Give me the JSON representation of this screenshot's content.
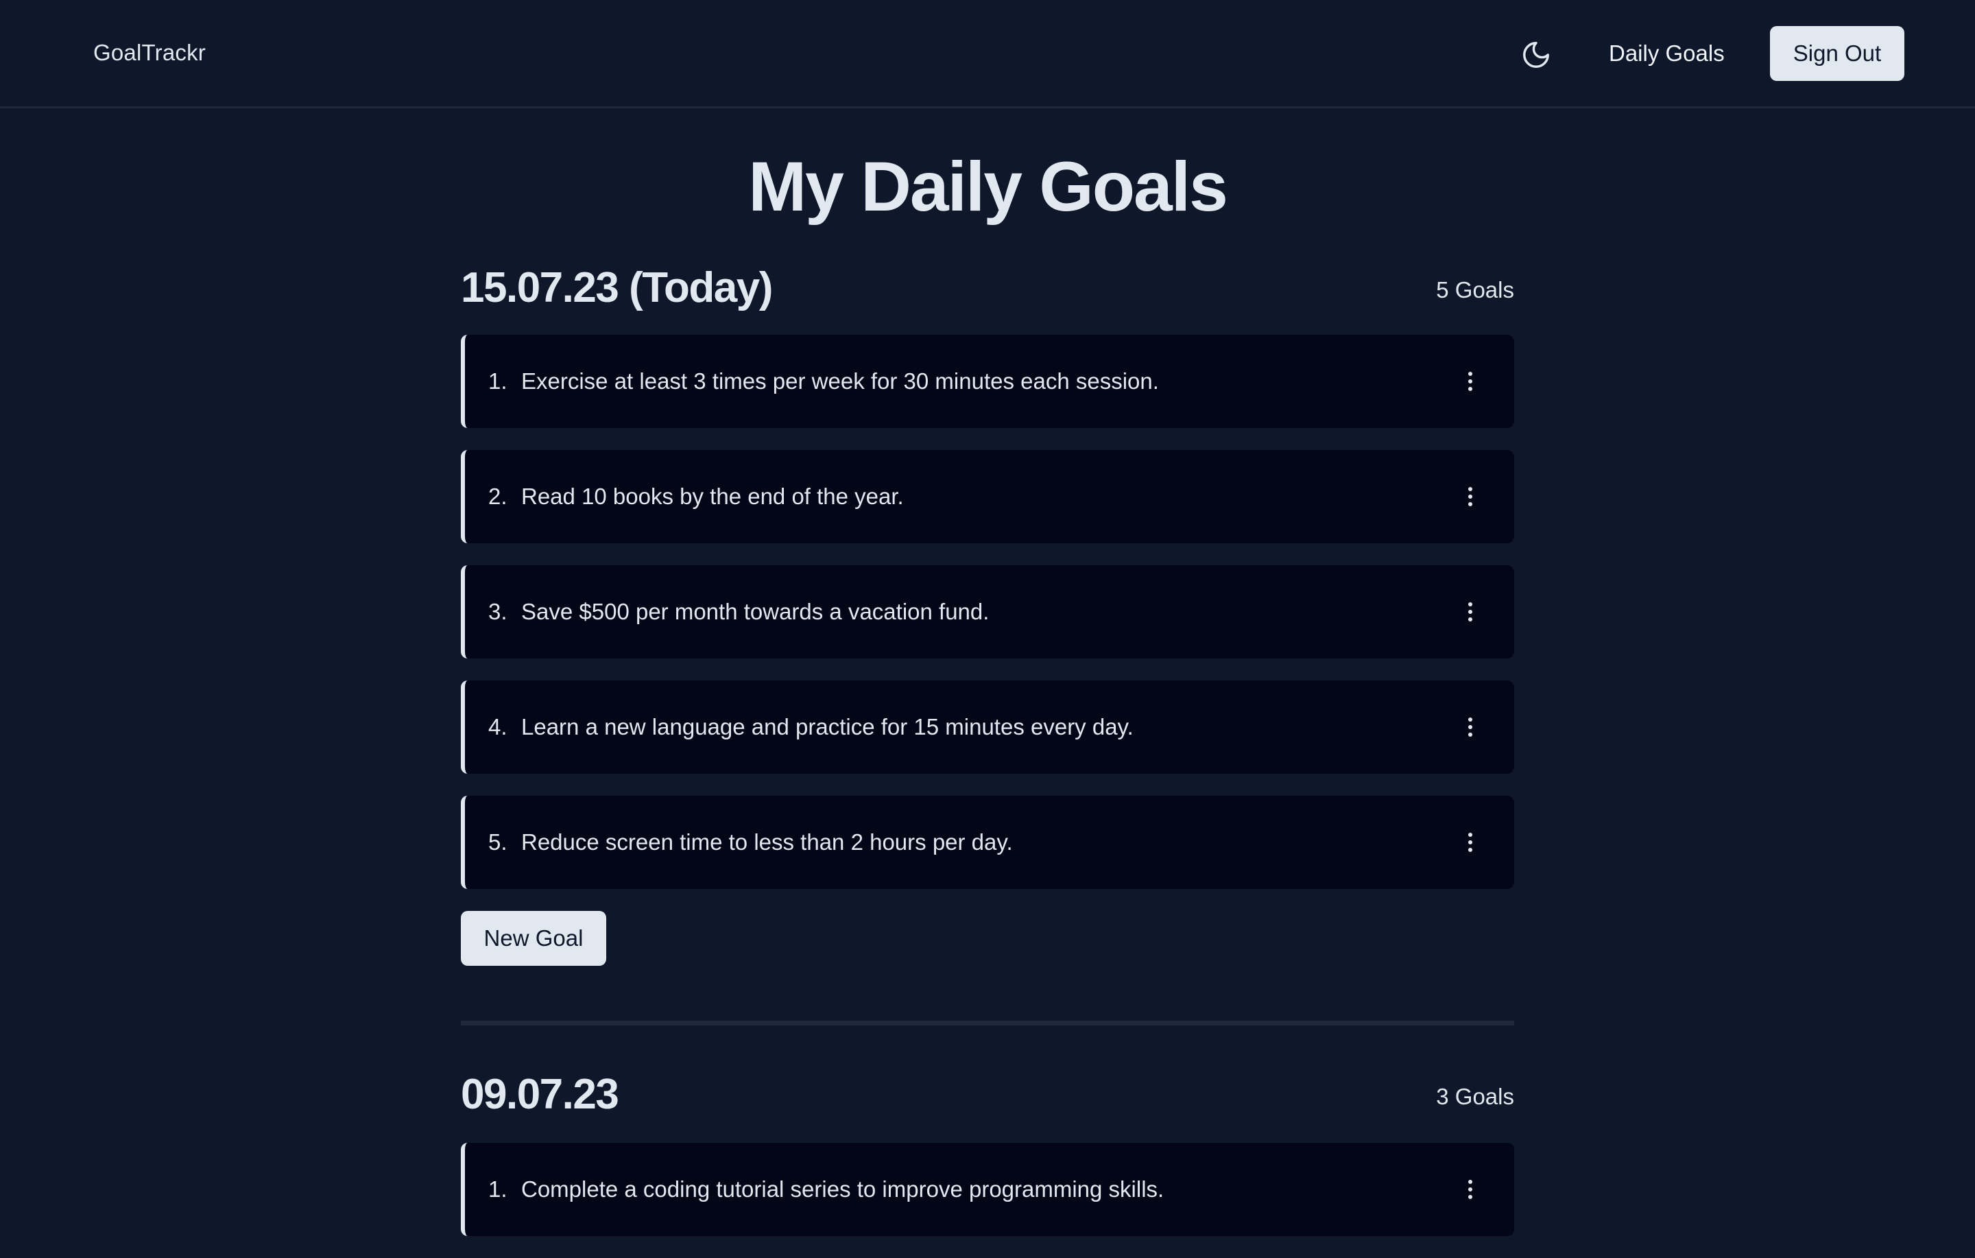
{
  "navbar": {
    "brand": "GoalTrackr",
    "theme_icon": "moon-icon",
    "nav_link": "Daily Goals",
    "sign_out_label": "Sign Out"
  },
  "page": {
    "title": "My Daily Goals"
  },
  "days": [
    {
      "date": "15.07.23 (Today)",
      "count": "5 Goals",
      "goals": [
        {
          "number": "1.",
          "text": "Exercise at least 3 times per week for 30 minutes each session."
        },
        {
          "number": "2.",
          "text": "Read 10 books by the end of the year."
        },
        {
          "number": "3.",
          "text": "Save $500 per month towards a vacation fund."
        },
        {
          "number": "4.",
          "text": "Learn a new language and practice for 15 minutes every day."
        },
        {
          "number": "5.",
          "text": "Reduce screen time to less than 2 hours per day."
        }
      ],
      "new_goal_label": "New Goal"
    },
    {
      "date": "09.07.23",
      "count": "3 Goals",
      "goals": [
        {
          "number": "1.",
          "text": "Complete a coding tutorial series to improve programming skills."
        }
      ]
    }
  ],
  "icons": {
    "goal_menu": "more-vertical-icon"
  },
  "colors": {
    "background": "#0f172a",
    "card": "#020617",
    "accent": "#e2e8f0",
    "divider": "#1e293b"
  }
}
